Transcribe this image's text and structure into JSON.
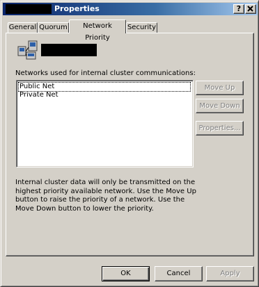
{
  "window": {
    "title": "Properties",
    "help_label": "?",
    "close_label": "x"
  },
  "tabs": [
    {
      "label": "General"
    },
    {
      "label": "Quorum"
    },
    {
      "label": "Network Priority"
    },
    {
      "label": "Security"
    }
  ],
  "main": {
    "list_label": "Networks used for internal cluster communications:",
    "networks": [
      "Public Net",
      "Private Net"
    ],
    "info": "Internal cluster data will only be transmitted on the highest priority available network. Use the Move Up button to raise the priority of a network. Use the Move Down button to lower the priority."
  },
  "side_buttons": {
    "move_up": "Move Up",
    "move_down": "Move Down",
    "properties": "Properties..."
  },
  "bottom_buttons": {
    "ok": "OK",
    "cancel": "Cancel",
    "apply": "Apply"
  },
  "colors": {
    "titlebar_start": "#0a246a",
    "titlebar_end": "#a6caf0",
    "face": "#d4d0c8"
  },
  "icons": {
    "cluster": "cluster-icon"
  }
}
